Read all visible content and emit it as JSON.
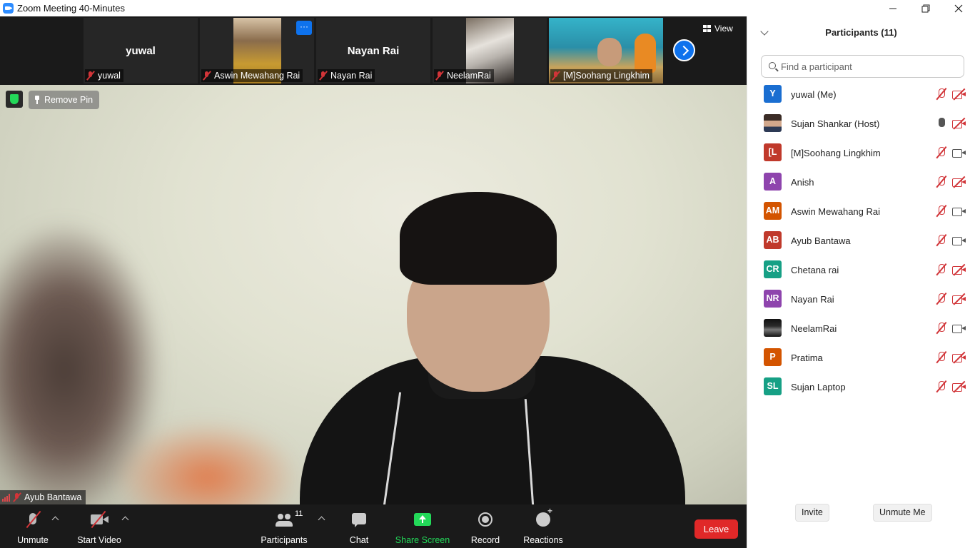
{
  "window": {
    "title": "Zoom Meeting 40-Minutes"
  },
  "strip": {
    "tiles": [
      {
        "big_name": "yuwal",
        "label": "yuwal"
      },
      {
        "label": "Aswin Mewahang Rai"
      },
      {
        "big_name": "Nayan Rai",
        "label": "Nayan Rai"
      },
      {
        "label": "NeelamRai"
      },
      {
        "label": "[M]Soohang Lingkhim"
      }
    ],
    "more_label": "···",
    "view_label": "View"
  },
  "main": {
    "remove_pin_label": "Remove Pin",
    "speaker_name": "Ayub Bantawa"
  },
  "toolbar": {
    "unmute": "Unmute",
    "start_video": "Start Video",
    "participants": "Participants",
    "participants_count": "11",
    "chat": "Chat",
    "share_screen": "Share Screen",
    "record": "Record",
    "reactions": "Reactions",
    "leave": "Leave"
  },
  "panel": {
    "title": "Participants (11)",
    "search_placeholder": "Find a participant",
    "participants": [
      {
        "initials": "Y",
        "color": "#1a6ed1",
        "name": "yuwal (Me)",
        "mic": "muted",
        "video": "off"
      },
      {
        "initials": "",
        "color": "#6b4e3d",
        "name": "Sujan Shankar (Host)",
        "mic": "live",
        "video": "off"
      },
      {
        "initials": "[L",
        "color": "#c0392b",
        "name": "[M]Soohang Lingkhim",
        "mic": "muted",
        "video": "on"
      },
      {
        "initials": "A",
        "color": "#8e44ad",
        "name": "Anish",
        "mic": "muted",
        "video": "off"
      },
      {
        "initials": "AM",
        "color": "#d35400",
        "name": "Aswin Mewahang Rai",
        "mic": "muted",
        "video": "on"
      },
      {
        "initials": "AB",
        "color": "#c0392b",
        "name": "Ayub Bantawa",
        "mic": "muted",
        "video": "on"
      },
      {
        "initials": "CR",
        "color": "#16a085",
        "name": "Chetana rai",
        "mic": "muted",
        "video": "off"
      },
      {
        "initials": "NR",
        "color": "#8e44ad",
        "name": "Nayan Rai",
        "mic": "muted",
        "video": "off"
      },
      {
        "initials": "",
        "color": "#1b1b1b",
        "name": "NeelamRai",
        "mic": "muted",
        "video": "on"
      },
      {
        "initials": "P",
        "color": "#d35400",
        "name": "Pratima",
        "mic": "muted",
        "video": "off"
      },
      {
        "initials": "SL",
        "color": "#16a085",
        "name": "Sujan Laptop",
        "mic": "muted",
        "video": "off"
      }
    ],
    "invite": "Invite",
    "unmute_me": "Unmute Me"
  },
  "colors": {
    "accent_blue": "#0e72ed",
    "leave_red": "#e02828",
    "share_green": "#23d959",
    "muted_red": "#d13438"
  }
}
